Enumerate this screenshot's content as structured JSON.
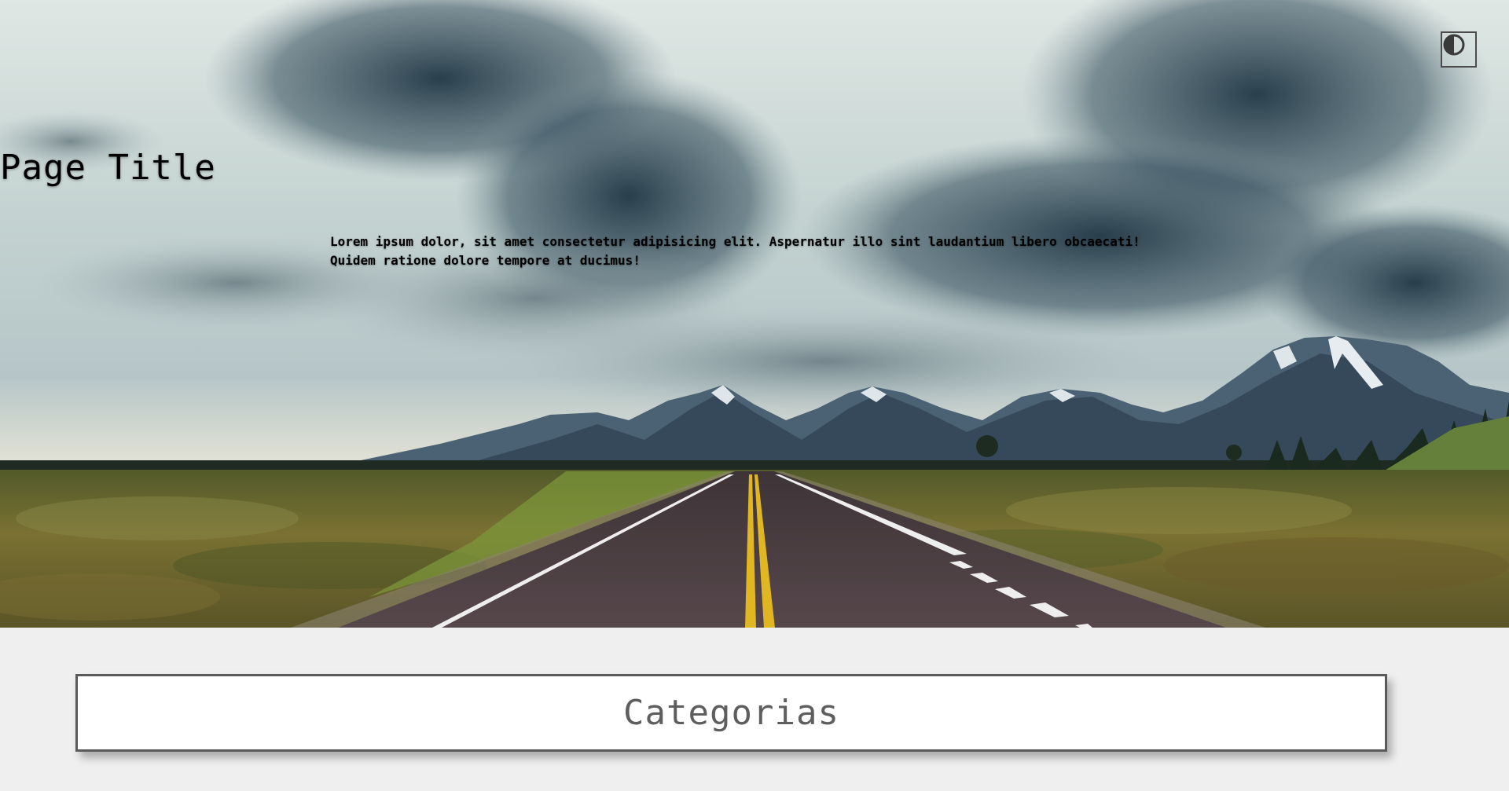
{
  "hero": {
    "title": "Page Title",
    "subtitle_line1": "Lorem ipsum dolor, sit amet consectetur adipisicing elit. Aspernatur illo sint laudantium libero obcaecati!",
    "subtitle_line2": "Quidem ratione dolore tempore at ducimus!",
    "background": {
      "sky": "#c9d6d4",
      "clouds": "#2f4553",
      "mountains": "#3c5466",
      "snow": "#dde4e8",
      "field": "#6b6a2c",
      "road": "#4a3f42",
      "center_line": "#e0b622",
      "edge_line": "#f2f2f2"
    },
    "theme_toggle_icon": "contrast-icon"
  },
  "categories": {
    "label": "Categorias"
  }
}
